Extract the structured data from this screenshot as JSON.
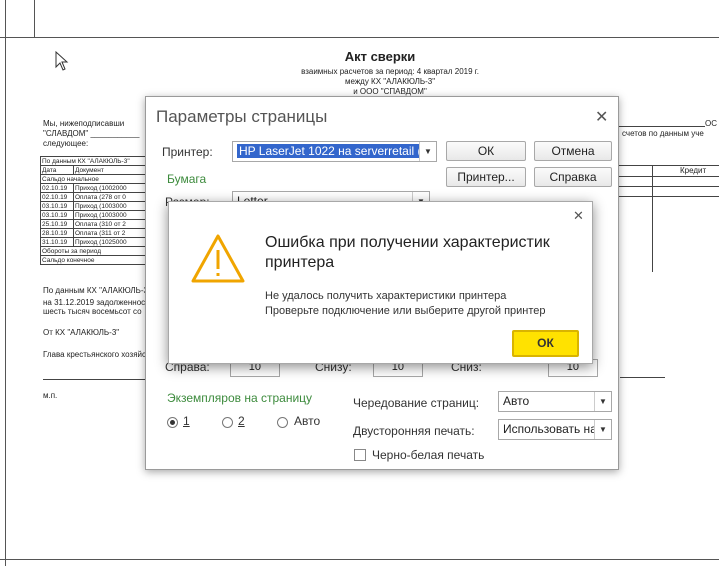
{
  "document": {
    "title": "Акт сверки",
    "subtitle_lines": [
      "взаимных расчетов за период: 4 квартал 2019 г.",
      "между КХ \"АЛАКЮЛЬ-3\"",
      "и ООО \"СПАВДОМ\""
    ],
    "intro_lines": [
      "Мы, нижеподписавши",
      "\"СЛАВДОМ\" ___________",
      "следующее:"
    ],
    "right_fragments": [
      "ОС",
      "счетов по данным уче"
    ],
    "table_header": "По данным КХ \"АЛАКЮЛЬ-3\"",
    "table_cols": [
      "Дата",
      "Документ"
    ],
    "table_rows": [
      [
        "Сальдо начальное",
        ""
      ],
      [
        "02.10.19",
        "Приход (1002000"
      ],
      [
        "02.10.19",
        "Оплата (278 от 0"
      ],
      [
        "03.10.19",
        "Приход (1003000"
      ],
      [
        "03.10.19",
        "Приход (1003000"
      ],
      [
        "25.10.19",
        "Оплата (310 от 2"
      ],
      [
        "28.10.19",
        "Оплата (311 от 2"
      ],
      [
        "31.10.19",
        "Приход (1025000"
      ],
      [
        "Обороты за период",
        ""
      ],
      [
        "Сальдо конечное",
        ""
      ]
    ],
    "right_cols": [
      "т",
      "Кредит"
    ],
    "footer_lines": [
      "По данным КХ \"АЛАКЮЛЬ-3\"",
      "на 31.12.2019 задолженност",
      "шесть тысяч восемьсот со"
    ],
    "from_label": "От КХ \"АЛАКЮЛЬ-3\"",
    "head_label": "Глава крестьянского хозяйст",
    "mp_label": "м.п."
  },
  "settings_dialog": {
    "title": "Параметры страницы",
    "printer_label": "Принтер:",
    "printer_value": "HP LaserJet 1022 на serverretail (п",
    "ok_label": "ОК",
    "cancel_label": "Отмена",
    "printer_btn_label": "Принтер...",
    "help_label": "Справка",
    "paper_section": "Бумага",
    "size_label": "Размер:",
    "size_value": "Letter",
    "right_margin_label": "Справа:",
    "right_margin_value": "10",
    "bottom_margin_label": "Снизу:",
    "bottom_margin_value": "10",
    "footer_margin_label": "Сниз:",
    "footer_margin_value": "10",
    "copies_section": "Экземпляров на страницу",
    "copies_options": [
      "1",
      "2",
      "Авто"
    ],
    "alternation_label": "Чередование страниц:",
    "alternation_value": "Авто",
    "duplex_label": "Двусторонняя печать:",
    "duplex_value": "Использовать на",
    "bw_label": "Черно-белая печать"
  },
  "error_dialog": {
    "title": "Ошибка при получении характеристик принтера",
    "message_line1": "Не удалось получить характеристики принтера",
    "message_line2": "Проверьте подключение или выберите другой принтер",
    "ok_label": "ОК"
  },
  "colors": {
    "selection": "#3366cc",
    "ok_button": "#ffe200",
    "warning": "#f0a500",
    "section_green": "#3d8b3d"
  }
}
